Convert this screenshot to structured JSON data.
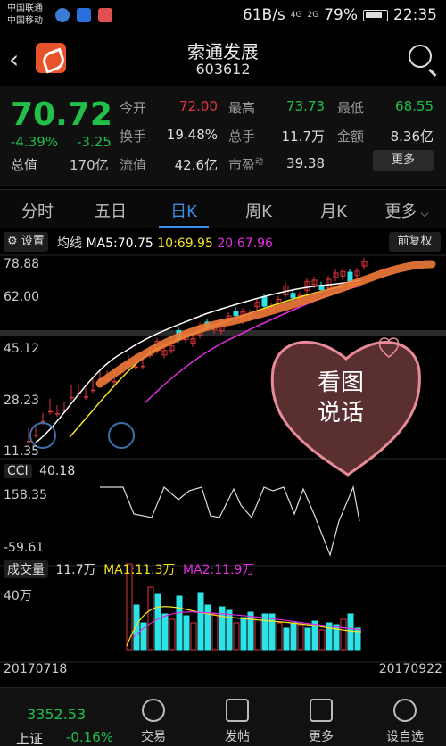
{
  "status_bar": {
    "carrier_1": "中国联通",
    "carrier_2": "中国移动",
    "speed": "61B/s",
    "net_1": "4G",
    "net_2": "2G",
    "battery": "79%",
    "time": "22:35"
  },
  "header": {
    "name": "索通发展",
    "code": "603612"
  },
  "quote": {
    "price": "70.72",
    "change_pct": "-4.39%",
    "change": "-3.25",
    "market_cap_label": "总值",
    "market_cap": "170亿",
    "open_label": "今开",
    "open": "72.00",
    "high_label": "最高",
    "high": "73.73",
    "low_label": "最低",
    "low": "68.55",
    "turnover_label": "换手",
    "turnover": "19.48%",
    "volume_label": "总手",
    "volume": "11.7万",
    "amount_label": "金额",
    "amount": "8.36亿",
    "float_cap_label": "流值",
    "float_cap": "42.6亿",
    "pe_label": "市盈",
    "pe_sup": "动",
    "pe": "39.38",
    "more_label": "更多"
  },
  "tabs": [
    "分时",
    "五日",
    "日K",
    "周K",
    "月K",
    "更多"
  ],
  "active_tab": "日K",
  "kline_toolbar": {
    "settings_label": "设置",
    "ma_prefix": "均线",
    "ma5": "MA5:70.75",
    "ma10": "10:69.95",
    "ma20": "20:67.96",
    "adjust_label": "前复权"
  },
  "price_axis": [
    "78.88",
    "62.00",
    "45.12",
    "28.23",
    "11.35"
  ],
  "cci": {
    "label": "CCI",
    "value": "40.18",
    "axis_top": "158.35",
    "axis_bottom": "-59.61"
  },
  "volume_panel": {
    "label": "成交量",
    "value": "11.7万",
    "ma1": "MA1:11.3万",
    "ma2": "MA2:11.9万",
    "axis_top": "40万"
  },
  "dates": {
    "start": "20170718",
    "end": "20170922"
  },
  "sticker": {
    "line_1": "看图",
    "line_2": "说话"
  },
  "bottom_nav": {
    "index_value": "3352.53",
    "index_name": "上证",
    "index_change": "-0.16%",
    "items": [
      "交易",
      "发帖",
      "更多",
      "设自选"
    ]
  },
  "colors": {
    "up": "#e0353e",
    "down": "#20c04a",
    "ma5": "#ffffff",
    "ma10": "#f2e320",
    "ma20": "#e02ee0",
    "accent": "#3d8ee8",
    "volume_bar": "#2ee3e8",
    "hand_line": "#f07a3a"
  }
}
